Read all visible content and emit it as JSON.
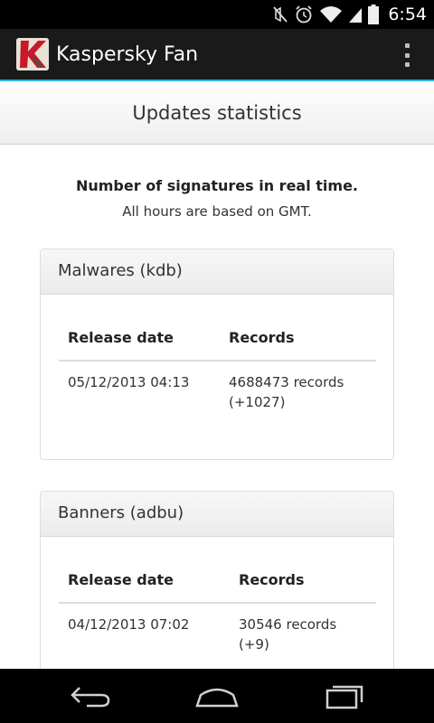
{
  "status_bar": {
    "time": "6:54",
    "icons": [
      "mute-icon",
      "alarm-icon",
      "wifi-icon",
      "signal-icon",
      "battery-icon"
    ]
  },
  "action_bar": {
    "title": "Kaspersky Fan",
    "icon": "kaspersky-logo-icon",
    "overflow_icon": "overflow-menu-icon"
  },
  "header": {
    "title": "Updates statistics"
  },
  "intro": {
    "title": "Number of signatures in real time.",
    "subtitle": "All hours are based on GMT."
  },
  "panels": [
    {
      "heading": "Malwares (kdb)",
      "columns": [
        "Release date",
        "Records"
      ],
      "rows": [
        {
          "date": "05/12/2013 04:13",
          "records": "4688473 records",
          "delta": "(+1027)"
        }
      ]
    },
    {
      "heading": "Banners (adbu)",
      "columns": [
        "Release date",
        "Records"
      ],
      "rows": [
        {
          "date": "04/12/2013 07:02",
          "records": "30546 records",
          "delta": "(+9)"
        }
      ]
    }
  ],
  "nav_bar": {
    "icons": [
      "back-icon",
      "home-icon",
      "recent-apps-icon"
    ]
  },
  "colors": {
    "accent": "#33b5e5",
    "action_bar": "#1a1a1a"
  }
}
